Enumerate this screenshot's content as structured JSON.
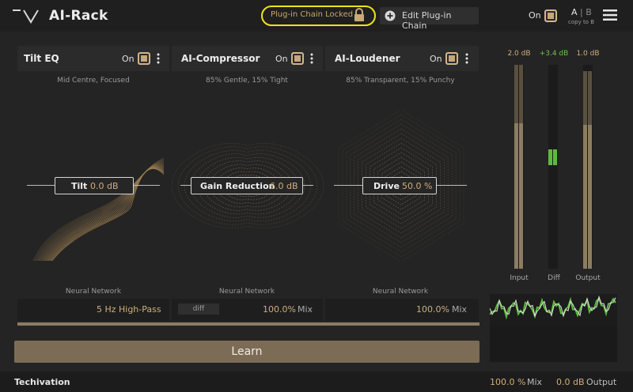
{
  "app": {
    "title": "AI-Rack"
  },
  "header": {
    "lock_label": "Plug-in Chain Locked",
    "edit_label": "Edit Plug-in Chain",
    "on_label": "On",
    "ab_a": "A",
    "ab_sep": "|",
    "ab_b": "B",
    "ab_sub": "copy to B"
  },
  "modules": [
    {
      "title": "Tilt EQ",
      "on_label": "On",
      "description": "Mid Centre, Focused",
      "param_name": "Tilt",
      "param_value": "0.0 dB",
      "network_label": "Neural Network",
      "footer_value": "5 Hz",
      "footer_unit": "High-Pass"
    },
    {
      "title": "AI-Compressor",
      "on_label": "On",
      "description": "85% Gentle, 15% Tight",
      "param_name": "Gain Reduction",
      "param_value": "6.0 dB",
      "network_label": "Neural Network",
      "footer_diff": "diff",
      "footer_value": "100.0%",
      "footer_unit": "Mix"
    },
    {
      "title": "AI-Loudener",
      "on_label": "On",
      "description": "85% Transparent, 15% Punchy",
      "param_name": "Drive",
      "param_value": "50.0 %",
      "network_label": "Neural Network",
      "footer_value": "100.0%",
      "footer_unit": "Mix"
    }
  ],
  "learn": {
    "label": "Learn"
  },
  "meters": {
    "input": {
      "value": "2.0 dB",
      "label": "Input"
    },
    "diff": {
      "value": "+3.4 dB",
      "label": "Diff"
    },
    "output": {
      "value": "1.0 dB",
      "label": "Output"
    }
  },
  "footer": {
    "brand": "Techivation",
    "mix_value": "100.0 %",
    "mix_unit": "Mix",
    "output_value": "0.0 dB",
    "output_unit": "Output"
  },
  "colors": {
    "accent": "#c6a77a",
    "highlight": "#f2e21a",
    "meter_green": "#5dbb3c"
  }
}
